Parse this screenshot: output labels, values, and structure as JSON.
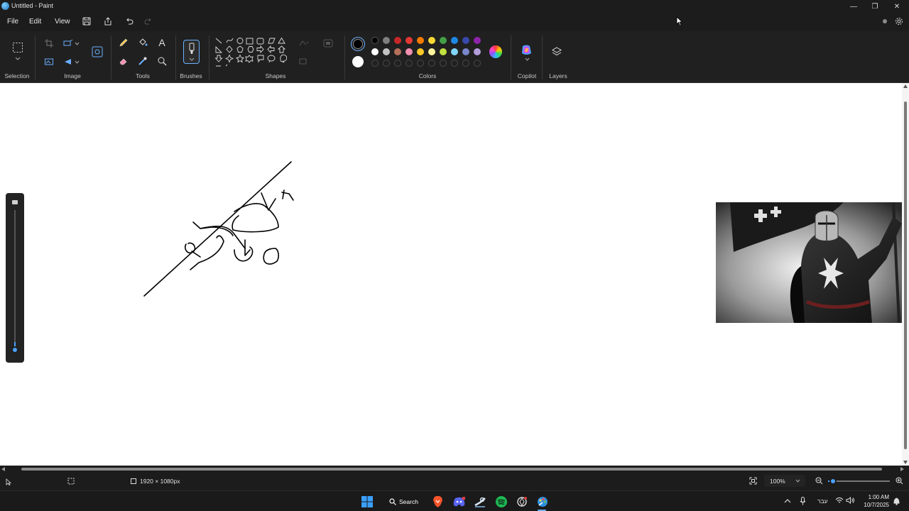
{
  "window": {
    "title": "Untitled - Paint",
    "minimize": "—",
    "maximize": "❐",
    "close": "✕"
  },
  "menu": {
    "file": "File",
    "edit": "Edit",
    "view": "View"
  },
  "ribbon": {
    "groups": {
      "selection": "Selection",
      "image": "Image",
      "tools": "Tools",
      "brushes": "Brushes",
      "shapes": "Shapes",
      "colors": "Colors",
      "copilot": "Copilot",
      "layers": "Layers"
    },
    "text_tool_glyph": "A",
    "primary_color": "#000000",
    "secondary_color": "#ffffff",
    "palette_row1": [
      "#000000",
      "#7f7f7f",
      "#c62828",
      "#e53935",
      "#f57c00",
      "#fdd835",
      "#43a047",
      "#1e88e5",
      "#3949ab",
      "#8e24aa"
    ],
    "palette_row2": [
      "#ffffff",
      "#c3c3c3",
      "#b5705a",
      "#f48fb1",
      "#ffca28",
      "#fff59d",
      "#c0e040",
      "#81d4fa",
      "#7986cb",
      "#b39ddb"
    ]
  },
  "canvas": {
    "size_label": "1920 × 1080px",
    "inserted_image": "knight-with-banner-photo"
  },
  "status": {
    "zoom": "100%",
    "zoom_level": 0.08
  },
  "taskbar": {
    "search": "Search",
    "language": "עבר",
    "time": "1:00 AM",
    "date": "10/7/2025"
  }
}
